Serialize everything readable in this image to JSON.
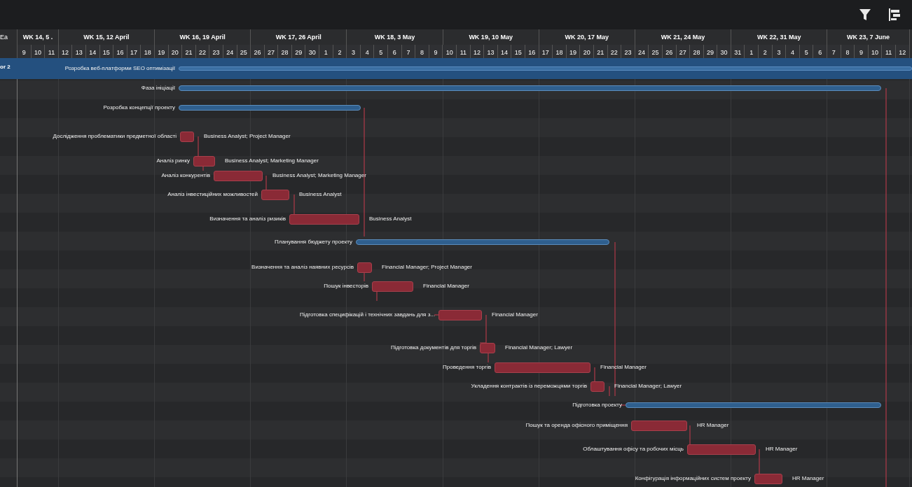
{
  "left_column": {
    "header": "Ea",
    "row": "or 2"
  },
  "timeline": {
    "weeks": [
      {
        "label": "WK 14, 5 ."
      },
      {
        "label": "WK 15, 12 April"
      },
      {
        "label": "WK 16, 19 April"
      },
      {
        "label": "WK 17, 26 April"
      },
      {
        "label": "WK 18, 3 May"
      },
      {
        "label": "WK 19, 10 May"
      },
      {
        "label": "WK 20, 17 May"
      },
      {
        "label": "WK 21, 24 May"
      },
      {
        "label": "WK 22, 31 May"
      },
      {
        "label": "WK 23, 7 June"
      }
    ],
    "days": [
      "9",
      "10",
      "11",
      "12",
      "13",
      "14",
      "15",
      "16",
      "17",
      "18",
      "19",
      "20",
      "21",
      "22",
      "23",
      "24",
      "25",
      "26",
      "27",
      "28",
      "29",
      "30",
      "1",
      "2",
      "3",
      "4",
      "5",
      "6",
      "7",
      "8",
      "9",
      "10",
      "11",
      "12",
      "13",
      "14",
      "15",
      "16",
      "17",
      "18",
      "19",
      "20",
      "21",
      "22",
      "23",
      "24",
      "25",
      "26",
      "27",
      "28",
      "29",
      "30",
      "31",
      "1",
      "2",
      "3",
      "4",
      "5",
      "6",
      "7",
      "8",
      "9",
      "10",
      "11",
      "12"
    ]
  },
  "tasks": [
    {
      "name": "Розробка веб-платформи SEO оптимізації",
      "kind": "project"
    },
    {
      "name": "Фаза ініціації",
      "kind": "summary"
    },
    {
      "name": "Розробка концепції проекту",
      "kind": "summary"
    },
    {
      "name": "Дослідження проблематики предметної області",
      "kind": "task",
      "resources": "Business Analyst; Project Manager"
    },
    {
      "name": "Аналіз ринку",
      "kind": "task",
      "resources": "Business Analyst; Marketing Manager"
    },
    {
      "name": "Аналіз конкурентів",
      "kind": "task",
      "resources": "Business Analyst; Marketing Manager"
    },
    {
      "name": "Аналіз інвестиційних можливостей",
      "kind": "task",
      "resources": "Business Analyst"
    },
    {
      "name": "Визначення та аналіз ризиків",
      "kind": "task",
      "resources": "Business Analyst"
    },
    {
      "name": "Планування бюджету проекту",
      "kind": "summary"
    },
    {
      "name": "Визначення та аналіз наявних ресурсів",
      "kind": "task",
      "resources": "Financial Manager; Project Manager"
    },
    {
      "name": "Пошук інвесторів",
      "kind": "task",
      "resources": "Financial Manager"
    },
    {
      "name": "Підготовка специфікацій і технічних завдань для з...",
      "kind": "task",
      "resources": "Financial Manager"
    },
    {
      "name": "Підготовка документів для торгів",
      "kind": "task",
      "resources": "Financial Manager; Lawyer"
    },
    {
      "name": "Проведення торгів",
      "kind": "task",
      "resources": "Financial Manager"
    },
    {
      "name": "Укладення контрактів із переможцями торгів",
      "kind": "task",
      "resources": "Financial Manager; Lawyer"
    },
    {
      "name": "Підготовка проекту",
      "kind": "summary"
    },
    {
      "name": "Пошук та оренда офісного приміщення",
      "kind": "task",
      "resources": "HR Manager"
    },
    {
      "name": "Облаштування офісу та робочих місць",
      "kind": "task",
      "resources": "HR Manager"
    },
    {
      "name": "Конфігурація інформаційних систем проекту",
      "kind": "task",
      "resources": "HR Manager"
    }
  ]
}
